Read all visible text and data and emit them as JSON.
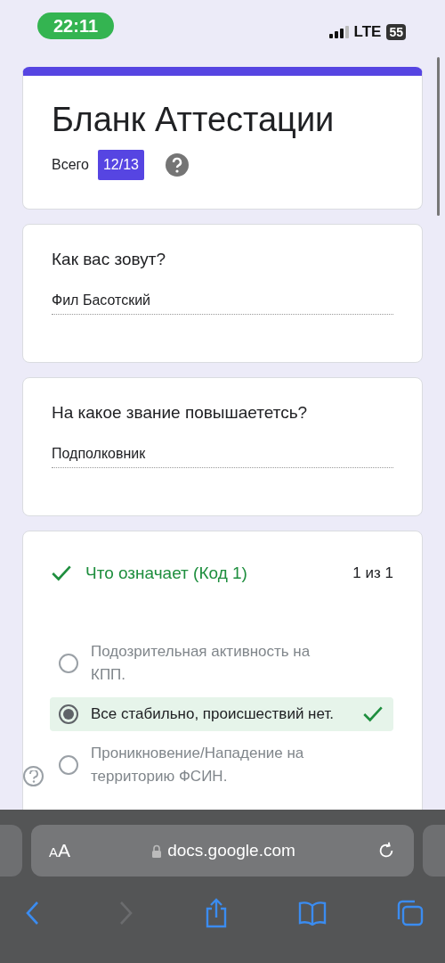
{
  "status_bar": {
    "time": "22:11",
    "network": "LTE",
    "battery": "55"
  },
  "form": {
    "title": "Бланк Аттестации",
    "total_label": "Всего",
    "score": "12/13"
  },
  "questions": [
    {
      "kind": "text",
      "question": "Как вас зовут?",
      "answer": "Фил Басотский"
    },
    {
      "kind": "text",
      "question": "На какое звание повышаететсь?",
      "answer": "Подполковник"
    },
    {
      "kind": "choice",
      "question": "Что означает (Код 1)",
      "correct": true,
      "points": "1 из 1",
      "options": [
        {
          "label": "Подозрительная активность на КПП.",
          "selected": false,
          "correct": false
        },
        {
          "label": "Все стабильно, происшествий нет.",
          "selected": true,
          "correct": true
        },
        {
          "label": "Проникновение/Нападение на территорию ФСИН.",
          "selected": false,
          "correct": false
        }
      ]
    }
  ],
  "browser": {
    "text_size": "AA",
    "url": "docs.google.com",
    "back_disabled": false,
    "forward_disabled": true
  }
}
